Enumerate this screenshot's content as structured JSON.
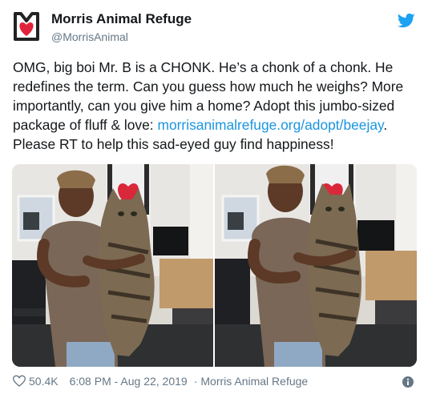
{
  "account": {
    "name": "Morris Animal Refuge",
    "handle": "@MorrisAnimal"
  },
  "tweet": {
    "text_before_link": "OMG, big boi Mr. B is a CHONK. He’s a chonk of a chonk. He redefines the term. Can you guess how much he weighs? More importantly, can you give him a home? Adopt this jumbo-sized package of fluff & love: ",
    "link": "morrisanimalrefuge.org/adopt/beejay",
    "text_after_link": ". Please RT to help this sad-eyed guy find happiness!"
  },
  "footer": {
    "likes": "50.4K",
    "timestamp": "6:08 PM - Aug 22, 2019",
    "separator": "·",
    "source": "Morris Animal Refuge"
  },
  "icons": {
    "logo": "morris-logo-icon",
    "bird": "twitter-bird-icon",
    "heart": "heart-icon",
    "info": "info-icon"
  },
  "colors": {
    "link": "#1b95e0",
    "secondary": "#657786",
    "bird": "#1da1f2",
    "logo_heart": "#e0233a"
  }
}
